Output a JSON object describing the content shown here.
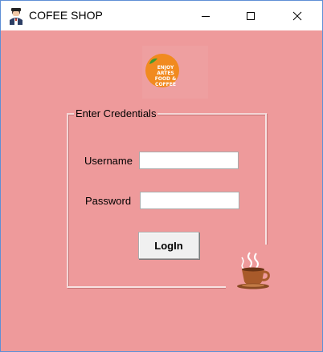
{
  "window": {
    "title": "COFEE SHOP"
  },
  "logo": {
    "lines": [
      "ENJOY",
      "ARTES",
      "FOOD &",
      "COFFEE"
    ]
  },
  "credentials": {
    "group_label": "Enter Credentials",
    "username_label": "Username",
    "username_value": "",
    "password_label": "Password",
    "password_value": "",
    "login_label": "LogIn"
  },
  "colors": {
    "background": "#ee9a9b",
    "logo_orange": "#f18a1f",
    "coffee_brown": "#a85a2a"
  },
  "icons": {
    "app": "barista-icon",
    "minimize": "minimize-icon",
    "maximize": "maximize-icon",
    "close": "close-icon",
    "coffee": "coffee-cup-icon"
  }
}
